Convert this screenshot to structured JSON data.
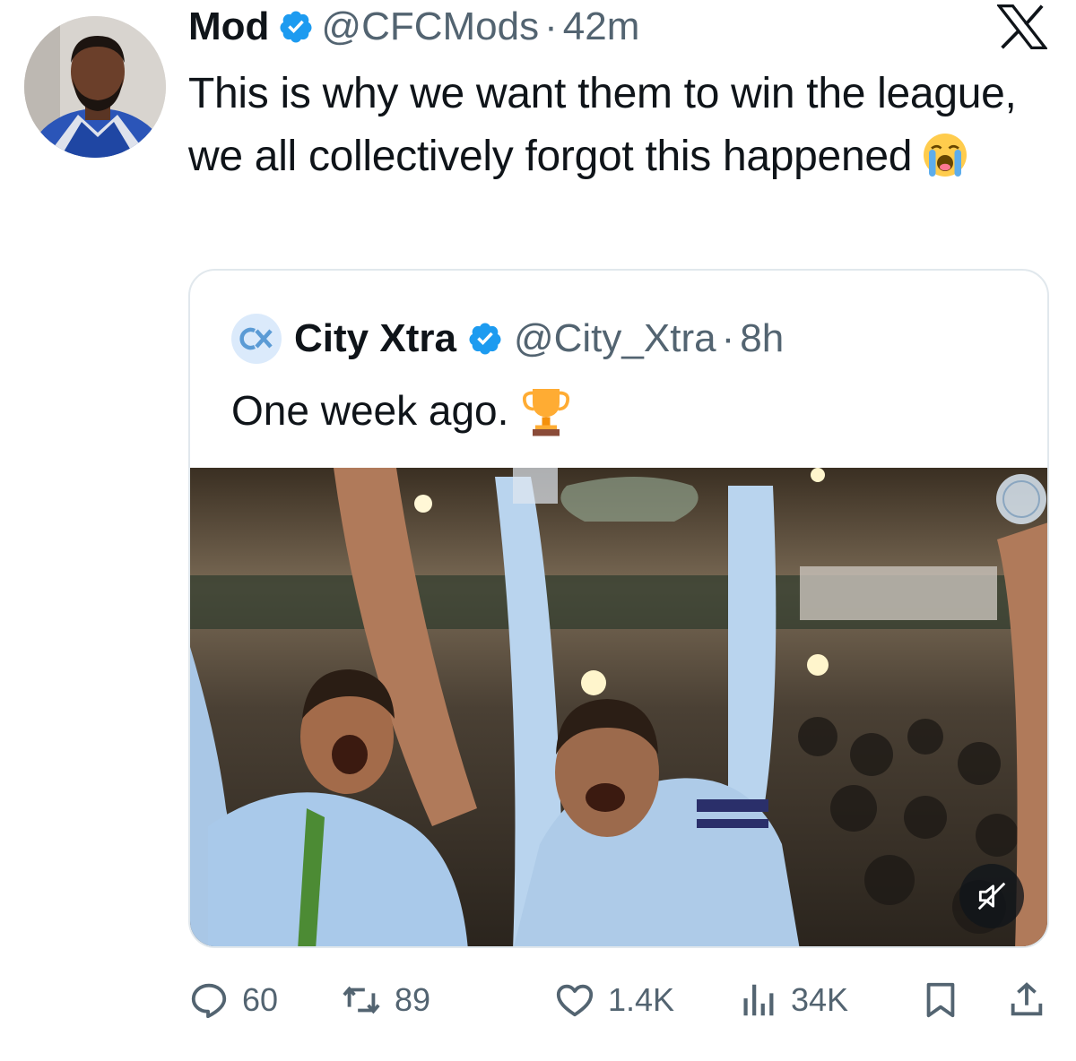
{
  "author": {
    "name": "Mod",
    "handle": "@CFCMods",
    "separator": "·",
    "time": "42m",
    "verified_color": "#1d9bf0"
  },
  "tweet": {
    "text": "This is why we want them to win the league, we all collectively forgot this happened",
    "emoji": "loudly-crying-face"
  },
  "quote": {
    "name": "City Xtra",
    "handle": "@City_Xtra",
    "separator": "·",
    "time": "8h",
    "text": "One week ago.",
    "emoji": "trophy",
    "media_icon": "volume-muted-icon"
  },
  "actions": {
    "replies": "60",
    "reposts": "89",
    "likes": "1.4K",
    "views": "34K"
  },
  "colors": {
    "text_primary": "#0f1419",
    "text_secondary": "#536471",
    "border": "#e1e8ed",
    "accent": "#1d9bf0"
  }
}
